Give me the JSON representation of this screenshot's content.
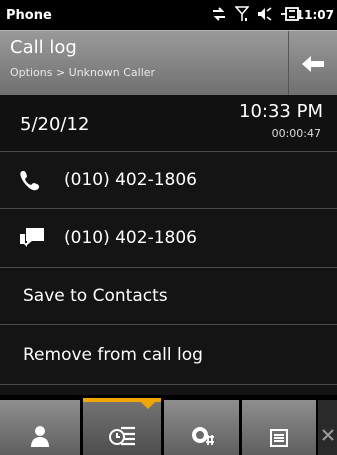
{
  "status_bar": {
    "app_name": "Phone",
    "time": "11:07",
    "icons": [
      "data-transfer-icon",
      "signal-icon",
      "volume-icon",
      "battery-charging-icon"
    ]
  },
  "header": {
    "title": "Call log",
    "breadcrumb": "Options > Unknown Caller",
    "back_icon": "back-arrow-icon"
  },
  "call": {
    "date": "5/20/12",
    "time": "10:33 PM",
    "duration": "00:00:47"
  },
  "actions": {
    "call_number": "(010) 402-1806",
    "text_number": "(010) 402-1806",
    "save_label": "Save to Contacts",
    "remove_label": "Remove from call log"
  },
  "toolbar": {
    "tabs": [
      {
        "icon": "contacts-icon",
        "active": false
      },
      {
        "icon": "call-log-icon",
        "active": true
      },
      {
        "icon": "dialpad-icon",
        "active": false
      },
      {
        "icon": "menu-icon",
        "active": false
      }
    ],
    "close_icon": "close-icon",
    "accent_color": "#f0a500"
  }
}
